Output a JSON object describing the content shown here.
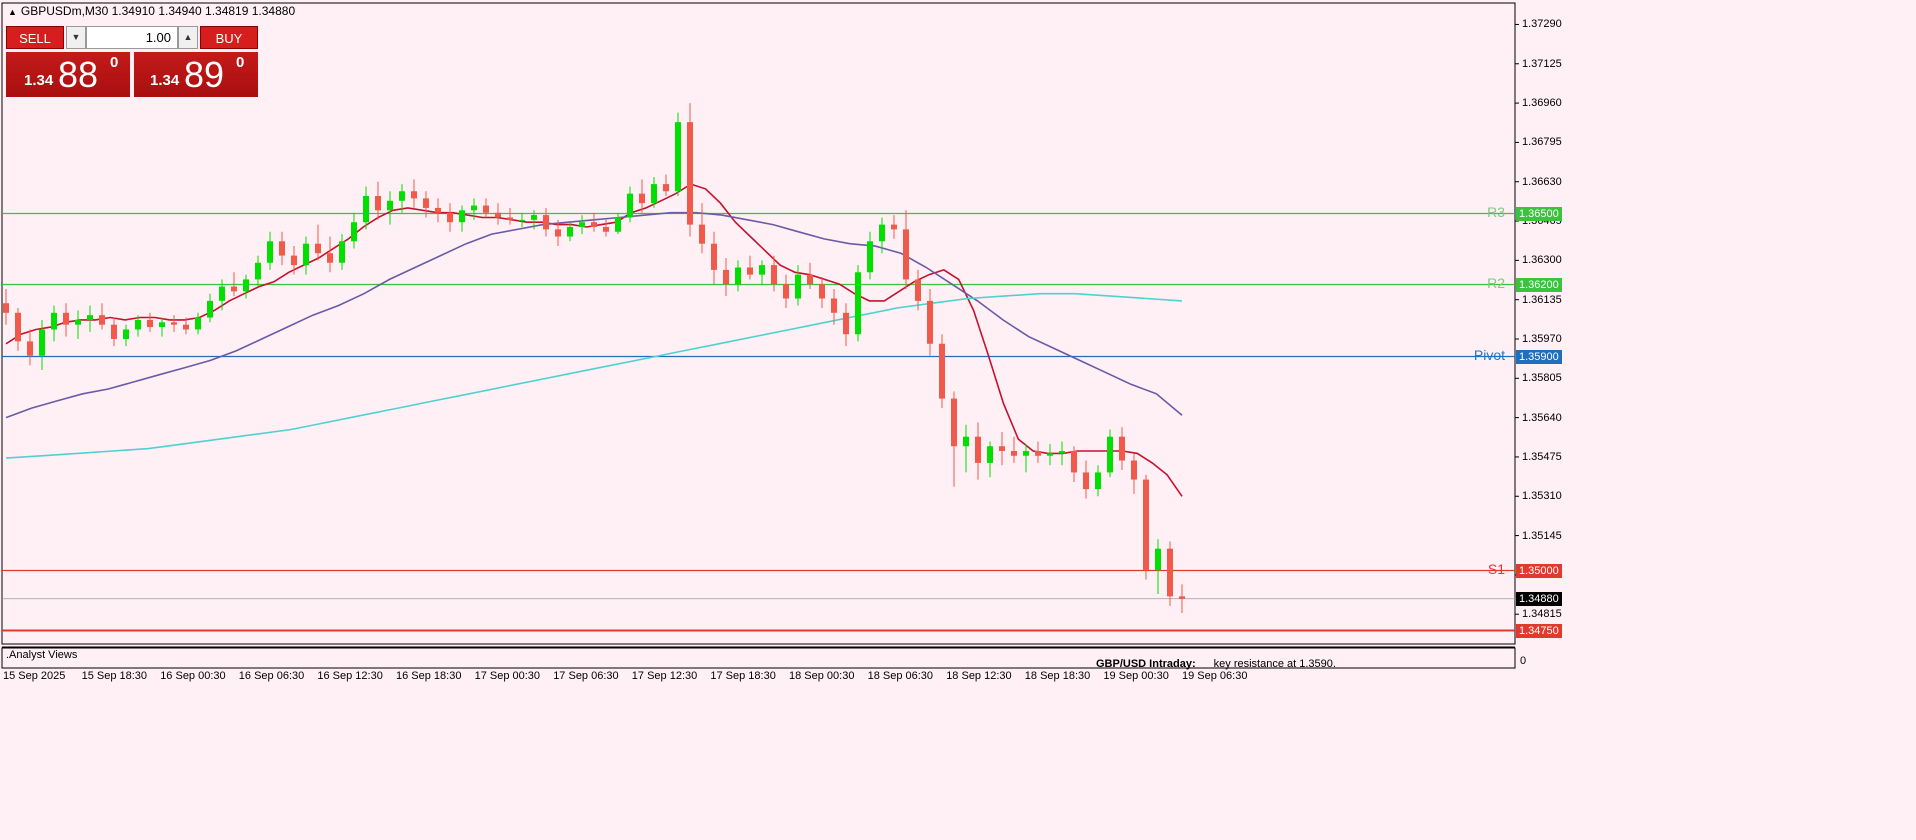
{
  "header": {
    "title": "GBPUSDm,M30  1.34910 1.34940 1.34819 1.34880"
  },
  "trade_panel": {
    "sell_label": "SELL",
    "buy_label": "BUY",
    "lot": "1.00",
    "sell_prefix": "1.34",
    "sell_big": "88",
    "sell_sup": "0",
    "buy_prefix": "1.34",
    "buy_big": "89",
    "buy_sup": "0"
  },
  "price_axis": {
    "ticks": [
      "1.37290",
      "1.37125",
      "1.36960",
      "1.36795",
      "1.36630",
      "1.36465",
      "1.36300",
      "1.36135",
      "1.35970",
      "1.35805",
      "1.35640",
      "1.35475",
      "1.35310",
      "1.35145",
      "1.34980",
      "1.34815"
    ],
    "current_price": "1.34880"
  },
  "levels": [
    {
      "name": "R3",
      "price": 1.365,
      "label": "1.36500",
      "color": "#39c43c",
      "name_color": "#7ec87f"
    },
    {
      "name": "R2",
      "price": 1.362,
      "label": "1.36200",
      "color": "#39c43c",
      "name_color": "#7ec87f"
    },
    {
      "name": "Pivot",
      "price": 1.359,
      "label": "1.35900",
      "color": "#1f6fbf",
      "name_color": "#1f78c8"
    },
    {
      "name": "S1",
      "price": 1.35,
      "label": "1.35000",
      "color": "#e0392e",
      "name_color": "#e0392e"
    },
    {
      "name": "",
      "price": 1.3475,
      "label": "1.34750",
      "color": "#e0392e",
      "name_color": "#e0392e"
    }
  ],
  "time_axis": [
    "15 Sep 2025",
    "15 Sep 18:30",
    "16 Sep 00:30",
    "16 Sep 06:30",
    "16 Sep 12:30",
    "16 Sep 18:30",
    "17 Sep 00:30",
    "17 Sep 06:30",
    "17 Sep 12:30",
    "17 Sep 18:30",
    "18 Sep 00:30",
    "18 Sep 06:30",
    "18 Sep 12:30",
    "18 Sep 18:30",
    "19 Sep 00:30",
    "19 Sep 06:30"
  ],
  "indicator_window": {
    "label": ".Analyst Views",
    "zero_label": "0",
    "note_title": "GBP/USD Intraday:",
    "note_text": "key resistance at 1.3590."
  },
  "colors": {
    "bull": "#00e000",
    "bear": "#ef5a4a",
    "ma_fast": "#c8102e",
    "ma_mid": "#6a5aa8",
    "ma_slow": "#4fd1cf",
    "background": "#fff0f5"
  },
  "chart_data": {
    "type": "candlestick",
    "symbol": "GBPUSDm",
    "timeframe": "M30",
    "ylim": [
      1.3469,
      1.3738
    ],
    "candles": [
      [
        1.3612,
        1.3618,
        1.3603,
        1.3608
      ],
      [
        1.3608,
        1.361,
        1.3592,
        1.3596
      ],
      [
        1.3596,
        1.3601,
        1.3586,
        1.359
      ],
      [
        1.359,
        1.3605,
        1.3584,
        1.3601
      ],
      [
        1.3601,
        1.3611,
        1.3596,
        1.3608
      ],
      [
        1.3608,
        1.3612,
        1.3598,
        1.3603
      ],
      [
        1.3603,
        1.3609,
        1.3597,
        1.3605
      ],
      [
        1.3605,
        1.3611,
        1.36,
        1.3607
      ],
      [
        1.3607,
        1.3612,
        1.3601,
        1.3603
      ],
      [
        1.3603,
        1.3606,
        1.3594,
        1.3597
      ],
      [
        1.3597,
        1.3603,
        1.3594,
        1.3601
      ],
      [
        1.3601,
        1.3607,
        1.3598,
        1.3605
      ],
      [
        1.3605,
        1.3608,
        1.36,
        1.3602
      ],
      [
        1.3602,
        1.3606,
        1.3598,
        1.3604
      ],
      [
        1.3604,
        1.3607,
        1.36,
        1.3603
      ],
      [
        1.3603,
        1.3606,
        1.3599,
        1.3601
      ],
      [
        1.3601,
        1.3608,
        1.3599,
        1.3606
      ],
      [
        1.3606,
        1.3616,
        1.3604,
        1.3613
      ],
      [
        1.3613,
        1.3622,
        1.3609,
        1.3619
      ],
      [
        1.3619,
        1.3625,
        1.3615,
        1.3617
      ],
      [
        1.3617,
        1.3624,
        1.3614,
        1.3622
      ],
      [
        1.3622,
        1.3632,
        1.3619,
        1.3629
      ],
      [
        1.3629,
        1.3642,
        1.3626,
        1.3638
      ],
      [
        1.3638,
        1.3642,
        1.3628,
        1.3632
      ],
      [
        1.3632,
        1.3636,
        1.3624,
        1.3628
      ],
      [
        1.3628,
        1.364,
        1.3624,
        1.3637
      ],
      [
        1.3637,
        1.3645,
        1.363,
        1.3633
      ],
      [
        1.3633,
        1.364,
        1.3625,
        1.3629
      ],
      [
        1.3629,
        1.3641,
        1.3626,
        1.3638
      ],
      [
        1.3638,
        1.365,
        1.3635,
        1.3646
      ],
      [
        1.3646,
        1.3661,
        1.3643,
        1.3657
      ],
      [
        1.3657,
        1.3663,
        1.3647,
        1.3651
      ],
      [
        1.3651,
        1.3659,
        1.3645,
        1.3655
      ],
      [
        1.3655,
        1.3662,
        1.365,
        1.3659
      ],
      [
        1.3659,
        1.3664,
        1.3652,
        1.3656
      ],
      [
        1.3656,
        1.3659,
        1.3648,
        1.3652
      ],
      [
        1.3652,
        1.3656,
        1.3646,
        1.365
      ],
      [
        1.365,
        1.3654,
        1.3642,
        1.3646
      ],
      [
        1.3646,
        1.3653,
        1.3642,
        1.3651
      ],
      [
        1.3651,
        1.3656,
        1.3647,
        1.3653
      ],
      [
        1.3653,
        1.3656,
        1.3648,
        1.365
      ],
      [
        1.365,
        1.3654,
        1.3645,
        1.3648
      ],
      [
        1.3648,
        1.3652,
        1.3645,
        1.3647
      ],
      [
        1.3647,
        1.365,
        1.3644,
        1.3647
      ],
      [
        1.3647,
        1.3651,
        1.3643,
        1.3649
      ],
      [
        1.3649,
        1.3652,
        1.364,
        1.3643
      ],
      [
        1.3643,
        1.3647,
        1.3636,
        1.364
      ],
      [
        1.364,
        1.3646,
        1.3638,
        1.3644
      ],
      [
        1.3644,
        1.3649,
        1.3641,
        1.3646
      ],
      [
        1.3646,
        1.365,
        1.3642,
        1.3644
      ],
      [
        1.3644,
        1.3647,
        1.364,
        1.3642
      ],
      [
        1.3642,
        1.365,
        1.3641,
        1.3648
      ],
      [
        1.3648,
        1.3661,
        1.3646,
        1.3658
      ],
      [
        1.3658,
        1.3664,
        1.365,
        1.3654
      ],
      [
        1.3654,
        1.3665,
        1.3652,
        1.3662
      ],
      [
        1.3662,
        1.3666,
        1.3657,
        1.3659
      ],
      [
        1.3659,
        1.3692,
        1.3657,
        1.3688
      ],
      [
        1.3688,
        1.3696,
        1.364,
        1.3645
      ],
      [
        1.3645,
        1.3654,
        1.3633,
        1.3637
      ],
      [
        1.3637,
        1.3642,
        1.362,
        1.3626
      ],
      [
        1.3626,
        1.3631,
        1.3615,
        1.362
      ],
      [
        1.362,
        1.363,
        1.3617,
        1.3627
      ],
      [
        1.3627,
        1.3632,
        1.3622,
        1.3624
      ],
      [
        1.3624,
        1.363,
        1.362,
        1.3628
      ],
      [
        1.3628,
        1.3632,
        1.3617,
        1.362
      ],
      [
        1.362,
        1.3624,
        1.361,
        1.3614
      ],
      [
        1.3614,
        1.3628,
        1.3611,
        1.3624
      ],
      [
        1.3624,
        1.3629,
        1.3618,
        1.362
      ],
      [
        1.362,
        1.3623,
        1.361,
        1.3614
      ],
      [
        1.3614,
        1.3618,
        1.3603,
        1.3608
      ],
      [
        1.3608,
        1.3612,
        1.3594,
        1.3599
      ],
      [
        1.3599,
        1.3628,
        1.3596,
        1.3625
      ],
      [
        1.3625,
        1.3642,
        1.3622,
        1.3638
      ],
      [
        1.3638,
        1.3648,
        1.3633,
        1.3645
      ],
      [
        1.3645,
        1.3649,
        1.3639,
        1.3643
      ],
      [
        1.3643,
        1.3651,
        1.3618,
        1.3622
      ],
      [
        1.3622,
        1.3626,
        1.3609,
        1.3613
      ],
      [
        1.3613,
        1.3618,
        1.359,
        1.3595
      ],
      [
        1.3595,
        1.3599,
        1.3568,
        1.3572
      ],
      [
        1.3572,
        1.3575,
        1.3535,
        1.3552
      ],
      [
        1.3552,
        1.3561,
        1.3541,
        1.3556
      ],
      [
        1.3556,
        1.3562,
        1.3538,
        1.3545
      ],
      [
        1.3545,
        1.3554,
        1.3539,
        1.3552
      ],
      [
        1.3552,
        1.3558,
        1.3544,
        1.355
      ],
      [
        1.355,
        1.3556,
        1.3545,
        1.3548
      ],
      [
        1.3548,
        1.3553,
        1.3541,
        1.355
      ],
      [
        1.355,
        1.3554,
        1.3545,
        1.3548
      ],
      [
        1.3548,
        1.3553,
        1.3544,
        1.3549
      ],
      [
        1.3549,
        1.3554,
        1.3544,
        1.355
      ],
      [
        1.355,
        1.3552,
        1.3537,
        1.3541
      ],
      [
        1.3541,
        1.3546,
        1.353,
        1.3534
      ],
      [
        1.3534,
        1.3544,
        1.3531,
        1.3541
      ],
      [
        1.3541,
        1.3559,
        1.3539,
        1.3556
      ],
      [
        1.3556,
        1.356,
        1.3542,
        1.3546
      ],
      [
        1.3546,
        1.3549,
        1.3532,
        1.3538
      ],
      [
        1.3538,
        1.354,
        1.3496,
        1.35
      ],
      [
        1.35,
        1.3513,
        1.349,
        1.3509
      ],
      [
        1.3509,
        1.3512,
        1.3485,
        1.3489
      ],
      [
        1.3489,
        1.3494,
        1.3482,
        1.3488
      ]
    ],
    "moving_averages": [
      {
        "color": "#c8102e",
        "values": [
          1.3595,
          1.3599,
          1.3601,
          1.3602,
          1.3604,
          1.3605,
          1.3605,
          1.3606,
          1.3605,
          1.3606,
          1.3606,
          1.3605,
          1.3605,
          1.3606,
          1.3609,
          1.3613,
          1.3616,
          1.3619,
          1.3621,
          1.3625,
          1.3628,
          1.3631,
          1.3635,
          1.3639,
          1.3644,
          1.3648,
          1.3651,
          1.3652,
          1.3651,
          1.365,
          1.365,
          1.3649,
          1.3648,
          1.3648,
          1.3647,
          1.3646,
          1.3646,
          1.3645,
          1.3645,
          1.3644,
          1.3645,
          1.3646,
          1.365,
          1.3652,
          1.3655,
          1.3658,
          1.3662,
          1.366,
          1.3654,
          1.3646,
          1.364,
          1.3634,
          1.3628,
          1.3625,
          1.3624,
          1.3622,
          1.362,
          1.3616,
          1.3613,
          1.3613,
          1.3617,
          1.3621,
          1.3624,
          1.3626,
          1.3622,
          1.3609,
          1.359,
          1.357,
          1.3555,
          1.355,
          1.3549,
          1.3549,
          1.355,
          1.355,
          1.355,
          1.355,
          1.3549,
          1.3545,
          1.354,
          1.3531
        ]
      },
      {
        "color": "#6a5aa8",
        "values": [
          1.3564,
          1.3568,
          1.3571,
          1.3574,
          1.3576,
          1.3579,
          1.3582,
          1.3585,
          1.3588,
          1.3592,
          1.3597,
          1.3602,
          1.3607,
          1.3611,
          1.3616,
          1.3622,
          1.3627,
          1.3632,
          1.3637,
          1.3641,
          1.3643,
          1.3645,
          1.3646,
          1.3647,
          1.3648,
          1.3649,
          1.365,
          1.365,
          1.3649,
          1.3647,
          1.3645,
          1.3642,
          1.3639,
          1.3637,
          1.3636,
          1.3633,
          1.3627,
          1.362,
          1.3613,
          1.3605,
          1.3598,
          1.3593,
          1.3588,
          1.3583,
          1.3578,
          1.3574,
          1.3565
        ]
      },
      {
        "color": "#4fd1cf",
        "values": [
          1.3547,
          1.3548,
          1.3549,
          1.355,
          1.3551,
          1.3553,
          1.3555,
          1.3557,
          1.3559,
          1.3562,
          1.3565,
          1.3568,
          1.3571,
          1.3574,
          1.3577,
          1.358,
          1.3583,
          1.3586,
          1.3589,
          1.3592,
          1.3595,
          1.3598,
          1.3601,
          1.3604,
          1.3607,
          1.361,
          1.3612,
          1.3614,
          1.3615,
          1.3616,
          1.3616,
          1.3615,
          1.3614,
          1.3613
        ]
      }
    ]
  }
}
